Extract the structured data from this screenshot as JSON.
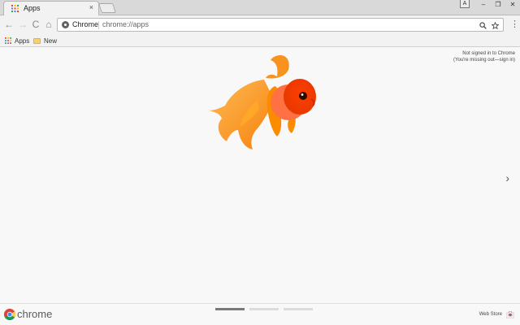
{
  "tab": {
    "title": "Apps",
    "close": "×"
  },
  "window_controls": {
    "profile": "A",
    "minimize": "–",
    "restore": "❐",
    "close": "✕"
  },
  "toolbar": {
    "back": "←",
    "forward": "→",
    "reload": "C",
    "home": "⌂",
    "omnibox": {
      "chip_label": "Chrome",
      "url": "chrome://apps"
    },
    "menu": "⋮"
  },
  "bookmarks": [
    {
      "label": "Apps"
    },
    {
      "label": "New"
    }
  ],
  "content": {
    "signin_line1": "Not signed in to Chrome",
    "signin_line2": "(You're missing out—sign in)",
    "next_arrow": "›"
  },
  "footer": {
    "wordmark": "chrome",
    "webstore_label": "Web Store",
    "pager": {
      "pages": 3,
      "active": 0
    }
  },
  "colors": {
    "apps_grid": [
      "#e94235",
      "#fbbc04",
      "#34a853",
      "#4285f4"
    ],
    "fish_body": "#f57c00",
    "fish_head": "#e53900"
  },
  "icons": {
    "tab_favicon": "apps-grid-icon",
    "zoom": "zoom-icon",
    "star": "star-icon",
    "fish": "goldfish-image"
  }
}
